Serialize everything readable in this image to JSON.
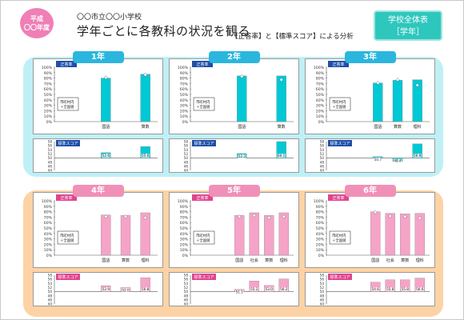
{
  "header": {
    "era_line1": "平成",
    "era_line2": "〇〇年度",
    "school_name": "〇〇市立〇〇小学校",
    "title": "学年ごとに各教科の状況を観る",
    "analysis_label": "【正答率】と【標準スコア】による分析",
    "scope_button_line1": "学校全体表",
    "scope_button_line2": "［学年］"
  },
  "colors": {
    "cyan_bar": "#00c8d4",
    "pink_bar": "#f6a3c8",
    "cyan_tab": "#2bb6de",
    "pink_tab": "#f090b8",
    "top_band": "#bff0f6",
    "bottom_band": "#fdd3a5",
    "legend_tag_cyan": "#1f4fa8",
    "legend_tag_pink": "#e0458f"
  },
  "legend": {
    "line1": "市町村内",
    "line2": "＋全国値"
  },
  "chart_data": [
    {
      "grade": "1年",
      "type": "bar",
      "theme": "cyan",
      "correct_rate": {
        "tag": "正答率",
        "y_ticks": [
          "100%",
          "90%",
          "80%",
          "70%",
          "60%",
          "50%",
          "40%",
          "30%",
          "20%",
          "10%",
          "0%"
        ],
        "ylim": [
          0,
          100
        ],
        "categories": [
          "国語",
          "",
          "算数"
        ],
        "values": [
          80,
          null,
          87
        ],
        "markers": [
          81,
          null,
          86
        ]
      },
      "standard_score": {
        "tag": "標準スコア",
        "y_ticks": [
          "58",
          "56",
          "54",
          "52",
          "50",
          "48",
          "46",
          "44"
        ],
        "ylim": [
          44,
          58
        ],
        "baseline": 50,
        "categories": [
          "国語",
          "",
          "算数"
        ],
        "values": [
          52.6,
          null,
          55.6
        ],
        "labels": [
          "52.6",
          "",
          "55.6"
        ]
      }
    },
    {
      "grade": "2年",
      "type": "bar",
      "theme": "cyan",
      "correct_rate": {
        "tag": "正答率",
        "y_ticks": [
          "100%",
          "90%",
          "80%",
          "70%",
          "60%",
          "50%",
          "40%",
          "30%",
          "20%",
          "10%",
          "0%"
        ],
        "ylim": [
          0,
          100
        ],
        "categories": [
          "国語",
          "",
          "算数"
        ],
        "values": [
          84,
          null,
          84
        ],
        "markers": [
          83,
          null,
          77
        ]
      },
      "standard_score": {
        "tag": "標準スコア",
        "y_ticks": [
          "58",
          "56",
          "54",
          "52",
          "50",
          "48",
          "46",
          "44"
        ],
        "ylim": [
          44,
          58
        ],
        "baseline": 50,
        "categories": [
          "国語",
          "",
          "算数"
        ],
        "values": [
          52.2,
          null,
          60.1
        ],
        "labels": [
          "52.2",
          "",
          "60.1"
        ]
      }
    },
    {
      "grade": "3年",
      "type": "bar",
      "theme": "cyan",
      "correct_rate": {
        "tag": "正答率",
        "y_ticks": [
          "100%",
          "90%",
          "80%",
          "70%",
          "60%",
          "50%",
          "40%",
          "30%",
          "20%",
          "10%",
          "0%"
        ],
        "ylim": [
          0,
          100
        ],
        "categories": [
          "国語",
          "算数",
          "理科"
        ],
        "values": [
          71,
          76,
          77
        ],
        "markers": [
          71,
          77,
          67
        ]
      },
      "standard_score": {
        "tag": "標準スコア",
        "y_ticks": [
          "58",
          "56",
          "54",
          "52",
          "50",
          "48",
          "46",
          "44"
        ],
        "ylim": [
          44,
          58
        ],
        "baseline": 50,
        "categories": [
          "国語",
          "算数",
          "理科"
        ],
        "values": [
          50.7,
          48.4,
          56.9
        ],
        "labels": [
          "50.7",
          "48.4",
          "56.9"
        ]
      }
    },
    {
      "grade": "4年",
      "type": "bar",
      "theme": "pink",
      "correct_rate": {
        "tag": "正答率",
        "y_ticks": [
          "100%",
          "90%",
          "80%",
          "70%",
          "60%",
          "50%",
          "40%",
          "30%",
          "20%",
          "10%",
          "0%"
        ],
        "ylim": [
          0,
          100
        ],
        "categories": [
          "国語",
          "算数",
          "理科"
        ],
        "values": [
          74,
          73,
          78
        ],
        "markers": [
          71,
          71,
          69
        ]
      },
      "standard_score": {
        "tag": "標準スコア",
        "y_ticks": [
          "58",
          "56",
          "54",
          "52",
          "50",
          "48",
          "46",
          "44"
        ],
        "ylim": [
          44,
          58
        ],
        "baseline": 50,
        "categories": [
          "国語",
          "算数",
          "理科"
        ],
        "values": [
          52.9,
          52.0,
          56.8
        ],
        "labels": [
          "52.9",
          "52.0",
          "56.8"
        ]
      }
    },
    {
      "grade": "5年",
      "type": "bar",
      "theme": "pink",
      "correct_rate": {
        "tag": "正答率",
        "y_ticks": [
          "100%",
          "90%",
          "80%",
          "70%",
          "60%",
          "50%",
          "40%",
          "30%",
          "20%",
          "10%",
          "0%"
        ],
        "ylim": [
          0,
          100
        ],
        "categories": [
          "国語",
          "社会",
          "算数",
          "理科"
        ],
        "values": [
          73,
          78,
          73,
          78
        ],
        "markers": [
          71,
          73,
          69,
          71
        ]
      },
      "standard_score": {
        "tag": "標準スコア",
        "y_ticks": [
          "58",
          "56",
          "54",
          "52",
          "50",
          "48",
          "46",
          "44"
        ],
        "ylim": [
          44,
          58
        ],
        "baseline": 50,
        "categories": [
          "国語",
          "社会",
          "算数",
          "理科"
        ],
        "values": [
          51.1,
          55.2,
          53.0,
          56.2
        ],
        "labels": [
          "51.1",
          "55.2",
          "53.0",
          "56.2"
        ]
      }
    },
    {
      "grade": "6年",
      "type": "bar",
      "theme": "pink",
      "correct_rate": {
        "tag": "正答率",
        "y_ticks": [
          "100%",
          "90%",
          "80%",
          "70%",
          "60%",
          "50%",
          "40%",
          "30%",
          "20%",
          "10%",
          "0%"
        ],
        "ylim": [
          0,
          100
        ],
        "categories": [
          "国語",
          "社会",
          "算数",
          "理科"
        ],
        "values": [
          80,
          77,
          76,
          77
        ],
        "markers": [
          79,
          72,
          71,
          68
        ]
      },
      "standard_score": {
        "tag": "標準スコア",
        "y_ticks": [
          "58",
          "56",
          "54",
          "52",
          "50",
          "48",
          "46",
          "44"
        ],
        "ylim": [
          44,
          58
        ],
        "baseline": 50,
        "categories": [
          "国語",
          "社会",
          "算数",
          "理科"
        ],
        "values": [
          54.6,
          55.8,
          55.8,
          56.6
        ],
        "labels": [
          "54.6",
          "55.8",
          "55.8",
          "56.6"
        ]
      }
    }
  ]
}
